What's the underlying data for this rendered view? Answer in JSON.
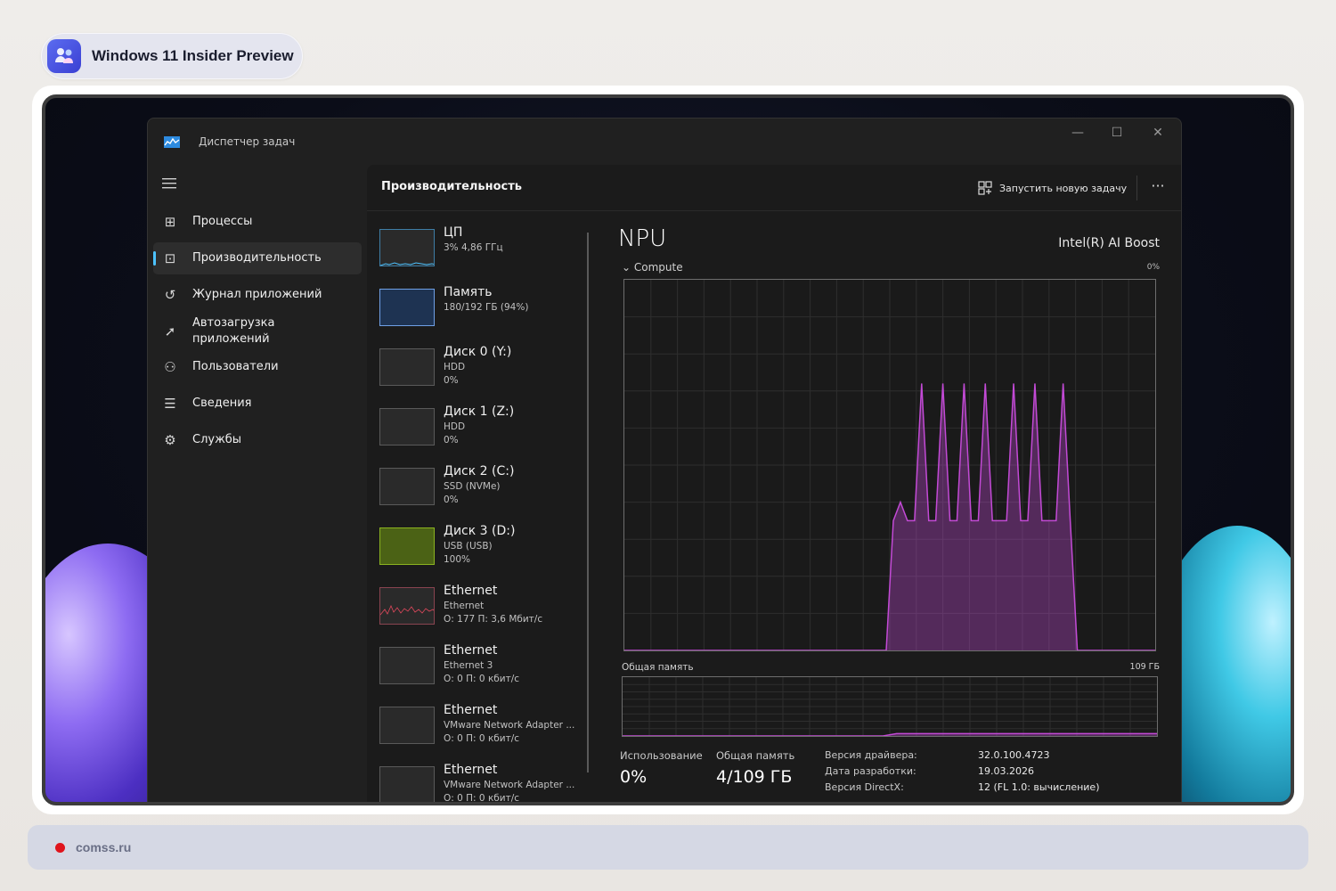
{
  "badge": {
    "label": "Windows 11 Insider Preview",
    "icon": "insider-logo-icon"
  },
  "window": {
    "title": "Диспетчер задач",
    "controls": {
      "minimize": "—",
      "maximize": "☐",
      "close": "✕"
    }
  },
  "sidebar": {
    "items": [
      {
        "label": "Процессы",
        "icon": "processes-icon",
        "glyph": "⊞"
      },
      {
        "label": "Производительность",
        "icon": "performance-icon",
        "glyph": "⊡"
      },
      {
        "label": "Журнал приложений",
        "icon": "app-history-icon",
        "glyph": "↺"
      },
      {
        "label": "Автозагрузка приложений",
        "icon": "startup-icon",
        "glyph": "➚"
      },
      {
        "label": "Пользователи",
        "icon": "users-icon",
        "glyph": "⚇"
      },
      {
        "label": "Сведения",
        "icon": "details-icon",
        "glyph": "☰"
      },
      {
        "label": "Службы",
        "icon": "services-icon",
        "glyph": "⚙"
      }
    ]
  },
  "main": {
    "title": "Производительность",
    "run_task": "Запустить новую задачу",
    "more": "···"
  },
  "resources": [
    {
      "name": "ЦП",
      "sub1": "3% 4,86 ГГц",
      "sub2": "",
      "thumb": "cpu"
    },
    {
      "name": "Память",
      "sub1": "180/192 ГБ (94%)",
      "sub2": "",
      "thumb": "memory"
    },
    {
      "name": "Диск 0 (Y:)",
      "sub1": "HDD",
      "sub2": "0%",
      "thumb": "empty"
    },
    {
      "name": "Диск 1 (Z:)",
      "sub1": "HDD",
      "sub2": "0%",
      "thumb": "empty"
    },
    {
      "name": "Диск 2 (C:)",
      "sub1": "SSD (NVMe)",
      "sub2": "0%",
      "thumb": "empty"
    },
    {
      "name": "Диск 3 (D:)",
      "sub1": "USB (USB)",
      "sub2": "100%",
      "thumb": "full"
    },
    {
      "name": "Ethernet",
      "sub1": "Ethernet",
      "sub2": "О: 177 П: 3,6 Мбит/с",
      "thumb": "net"
    },
    {
      "name": "Ethernet",
      "sub1": "Ethernet 3",
      "sub2": "О: 0 П: 0 кбит/с",
      "thumb": "empty"
    },
    {
      "name": "Ethernet",
      "sub1": "VMware Network Adapter ...",
      "sub2": "О: 0 П: 0 кбит/с",
      "thumb": "empty"
    },
    {
      "name": "Ethernet",
      "sub1": "VMware Network Adapter ...",
      "sub2": "О: 0 П: 0 кбит/с",
      "thumb": "empty"
    }
  ],
  "npu": {
    "title": "NPU",
    "device": "Intel(R) AI Boost",
    "engine": "Compute",
    "engine_max": "0%",
    "shared_mem_label": "Общая память",
    "shared_mem_max": "109 ГБ",
    "stats": [
      {
        "label": "Использование",
        "value": "0%"
      },
      {
        "label": "Общая память",
        "value": "4/109 ГБ"
      }
    ],
    "info": [
      {
        "label": "Версия драйвера:",
        "value": "32.0.100.4723"
      },
      {
        "label": "Дата разработки:",
        "value": "19.03.2026"
      },
      {
        "label": "Версия DirectX:",
        "value": "12 (FL 1.0: вычисление)"
      }
    ],
    "usage_series": [
      0,
      0,
      0,
      0,
      0,
      0,
      0,
      0,
      0,
      0,
      0,
      0,
      0,
      0,
      0,
      0,
      0,
      0,
      0,
      0,
      0,
      0,
      0,
      0,
      0,
      0,
      0,
      0,
      0,
      0,
      0,
      0,
      0,
      0,
      0,
      0,
      0,
      0,
      35,
      40,
      35,
      35,
      72,
      35,
      35,
      72,
      35,
      35,
      72,
      35,
      35,
      72,
      35,
      35,
      35,
      72,
      35,
      35,
      72,
      35,
      35,
      35,
      72,
      35,
      0,
      0,
      0,
      0,
      0,
      0,
      0,
      0,
      0,
      0,
      0,
      0
    ],
    "memory_series": [
      0,
      0,
      0,
      0,
      0,
      0,
      0,
      0,
      0,
      0,
      0,
      0,
      0,
      0,
      0,
      0,
      0,
      0,
      0,
      0,
      4,
      4,
      4,
      4,
      4,
      4,
      4,
      4,
      4,
      4,
      4,
      4,
      4,
      4,
      4,
      4,
      4,
      4,
      4,
      4
    ]
  },
  "colors": {
    "npu": "#c34ad6",
    "accent": "#4cc2ff",
    "memory": "#6fa0e6",
    "disk_full": "#8bb320",
    "net": "#e0485c"
  },
  "footer": {
    "site": "comss.ru"
  }
}
